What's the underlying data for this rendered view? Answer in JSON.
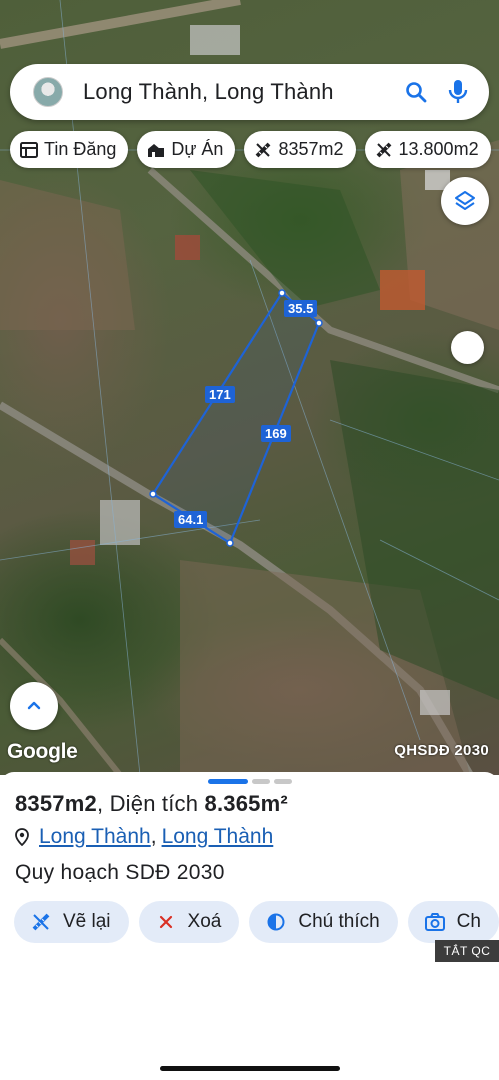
{
  "search": {
    "query": "Long Thành, Long Thành"
  },
  "chips": [
    {
      "label": "Tin Đăng",
      "icon": "listing-icon"
    },
    {
      "label": "Dự Án",
      "icon": "project-icon"
    },
    {
      "label": "8357m2",
      "icon": "ruler-icon"
    },
    {
      "label": "13.800m2",
      "icon": "ruler-icon"
    }
  ],
  "map": {
    "measurements": {
      "top": "35.5",
      "left": "171",
      "right": "169",
      "bottom": "64.1"
    },
    "attribution": "Google",
    "overlay_label": "QHSDĐ 2030",
    "polygon_color": "#1e63d6"
  },
  "sheet": {
    "title_name": "8357m2",
    "title_area_prefix": ", Diện tích ",
    "title_area_value": "8.365m²",
    "location_part1": "Long Thành",
    "location_separator": ",",
    "location_part2": "Long Thành",
    "subtitle": "Quy hoạch SDĐ 2030",
    "actions": [
      {
        "label": "Vẽ lại",
        "icon": "redraw-icon"
      },
      {
        "label": "Xoá",
        "icon": "close-icon"
      },
      {
        "label": "Chú thích",
        "icon": "contrast-icon"
      },
      {
        "label": "Ch",
        "icon": "camera-icon"
      }
    ],
    "ad_label": "TẮT QC"
  },
  "colors": {
    "accent": "#1a73e8",
    "action_bg": "#e3ebf8",
    "link": "#1a5fb4"
  }
}
